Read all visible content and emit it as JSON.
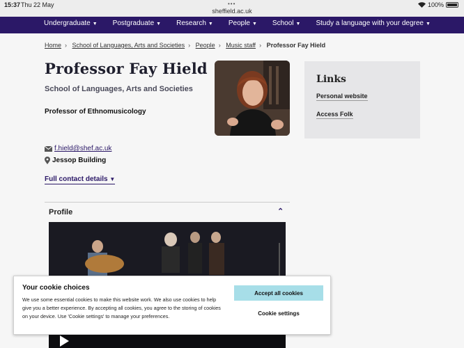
{
  "status_bar": {
    "time": "15:37",
    "date": "Thu 22 May",
    "url": "sheffield.ac.uk",
    "battery": "100%"
  },
  "nav": {
    "items": [
      {
        "label": "Undergraduate"
      },
      {
        "label": "Postgraduate"
      },
      {
        "label": "Research"
      },
      {
        "label": "People"
      },
      {
        "label": "School"
      },
      {
        "label": "Study a language with your degree"
      }
    ]
  },
  "breadcrumb": {
    "items": [
      "Home",
      "School of Languages, Arts and Societies",
      "People",
      "Music staff"
    ],
    "current": "Professor Fay Hield"
  },
  "profile": {
    "name": "Professor Fay Hield",
    "school": "School of Languages, Arts and Societies",
    "role": "Professor of Ethnomusicology",
    "email": "f.hield@shef.ac.uk",
    "building": "Jessop Building",
    "contact_link": "Full contact details",
    "section_title": "Profile"
  },
  "links": {
    "title": "Links",
    "items": [
      "Personal website",
      "Access Folk"
    ]
  },
  "cookie": {
    "title": "Your cookie choices",
    "text": "We use some essential cookies to make this website work. We also use cookies to help give you a better experience. By accepting all cookies, you agree to the storing of cookies on your device. Use 'Cookie settings' to manage your preferences.",
    "accept_label": "Accept all cookies",
    "settings_label": "Cookie settings"
  },
  "colors": {
    "nav": "#2b1867",
    "accent": "#a7dee8",
    "links_bg": "#e6e6e8"
  }
}
